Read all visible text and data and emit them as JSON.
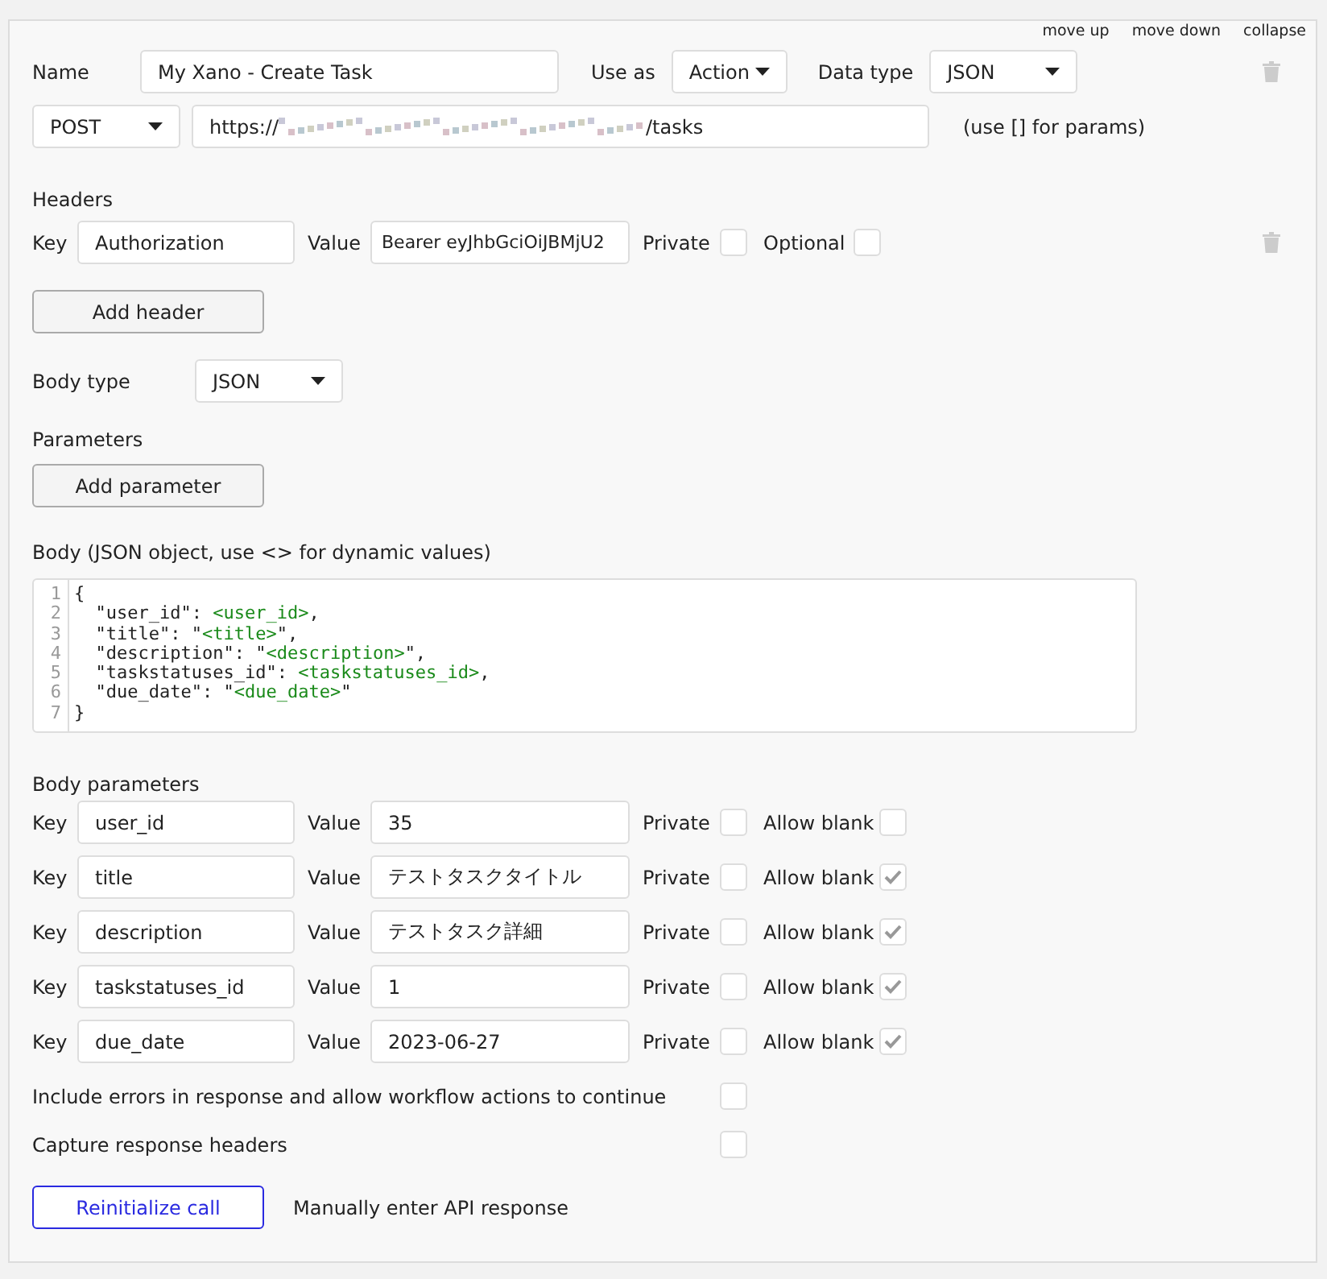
{
  "top_links": [
    "move up",
    "move down",
    "collapse"
  ],
  "name": {
    "label": "Name",
    "value": "My Xano - Create Task"
  },
  "use_as": {
    "label": "Use as",
    "value": "Action"
  },
  "data_type": {
    "label": "Data type",
    "value": "JSON"
  },
  "method": {
    "value": "POST"
  },
  "url": {
    "prefix": "https://",
    "suffix": "/tasks",
    "hint": "(use [] for params)"
  },
  "headers": {
    "title": "Headers",
    "rows": [
      {
        "key_label": "Key",
        "key": "Authorization",
        "value_label": "Value",
        "value": "Bearer eyJhbGciOiJBMjU2",
        "private_label": "Private",
        "private": false,
        "optional_label": "Optional",
        "optional": false
      }
    ]
  },
  "add_header": "Add header",
  "body_type": {
    "label": "Body type",
    "value": "JSON"
  },
  "parameters": {
    "title": "Parameters",
    "button": "Add parameter"
  },
  "body": {
    "title": "Body (JSON object, use <> for dynamic values)",
    "lines": [
      {
        "number": "1",
        "segments": [
          {
            "kind": "plain",
            "text": "{"
          }
        ]
      },
      {
        "number": "2",
        "segments": [
          {
            "kind": "plain",
            "text": "  \"user_id\": "
          },
          {
            "kind": "var",
            "text": "<user_id>"
          },
          {
            "kind": "plain",
            "text": ","
          }
        ]
      },
      {
        "number": "3",
        "segments": [
          {
            "kind": "plain",
            "text": "  \"title\": \""
          },
          {
            "kind": "var",
            "text": "<title>"
          },
          {
            "kind": "plain",
            "text": "\","
          }
        ]
      },
      {
        "number": "4",
        "segments": [
          {
            "kind": "plain",
            "text": "  \"description\": \""
          },
          {
            "kind": "var",
            "text": "<description>"
          },
          {
            "kind": "plain",
            "text": "\","
          }
        ]
      },
      {
        "number": "5",
        "segments": [
          {
            "kind": "plain",
            "text": "  \"taskstatuses_id\": "
          },
          {
            "kind": "var",
            "text": "<taskstatuses_id>"
          },
          {
            "kind": "plain",
            "text": ","
          }
        ]
      },
      {
        "number": "6",
        "segments": [
          {
            "kind": "plain",
            "text": "  \"due_date\": \""
          },
          {
            "kind": "var",
            "text": "<due_date>"
          },
          {
            "kind": "plain",
            "text": "\""
          }
        ]
      },
      {
        "number": "7",
        "segments": [
          {
            "kind": "plain",
            "text": "}"
          }
        ]
      }
    ]
  },
  "body_parameters": {
    "title": "Body parameters",
    "rows": [
      {
        "key_label": "Key",
        "key": "user_id",
        "value_label": "Value",
        "value": "35",
        "private_label": "Private",
        "private": false,
        "blank_label": "Allow blank",
        "allow_blank": false
      },
      {
        "key_label": "Key",
        "key": "title",
        "value_label": "Value",
        "value": "テストタスクタイトル",
        "private_label": "Private",
        "private": false,
        "blank_label": "Allow blank",
        "allow_blank": true
      },
      {
        "key_label": "Key",
        "key": "description",
        "value_label": "Value",
        "value": "テストタスク詳細",
        "private_label": "Private",
        "private": false,
        "blank_label": "Allow blank",
        "allow_blank": true
      },
      {
        "key_label": "Key",
        "key": "taskstatuses_id",
        "value_label": "Value",
        "value": "1",
        "private_label": "Private",
        "private": false,
        "blank_label": "Allow blank",
        "allow_blank": true
      },
      {
        "key_label": "Key",
        "key": "due_date",
        "value_label": "Value",
        "value": "2023-06-27",
        "private_label": "Private",
        "private": false,
        "blank_label": "Allow blank",
        "allow_blank": true
      }
    ]
  },
  "options": [
    {
      "label": "Include errors in response and allow workflow actions to continue",
      "checked": false
    },
    {
      "label": "Capture response headers",
      "checked": false
    }
  ],
  "reinitialize": "Reinitialize call",
  "manual": "Manually enter API response"
}
